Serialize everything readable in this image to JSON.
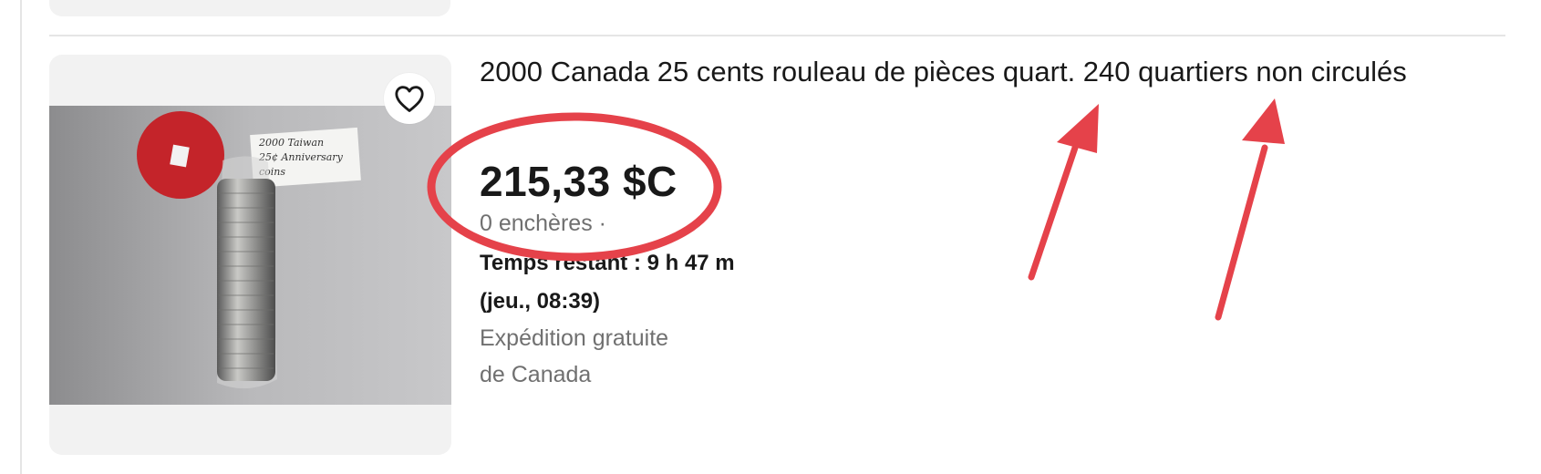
{
  "listing": {
    "title": "2000 Canada 25 cents rouleau de pièces quart. 240 quartiers non circulés",
    "price": "215,33 $C",
    "bids": "0 enchères ·",
    "time_left": "Temps restant : 9 h 47 m",
    "end_time": "(jeu., 08:39)",
    "shipping": "Expédition gratuite",
    "origin": "de Canada",
    "photo_note": [
      "2000 Taiwan",
      "25¢ Anniversary",
      "coins"
    ],
    "watch_icon": "heart-icon"
  },
  "colors": {
    "annotation_red": "#e5424a",
    "card_bg": "#f2f2f2",
    "muted_text": "#707070"
  }
}
